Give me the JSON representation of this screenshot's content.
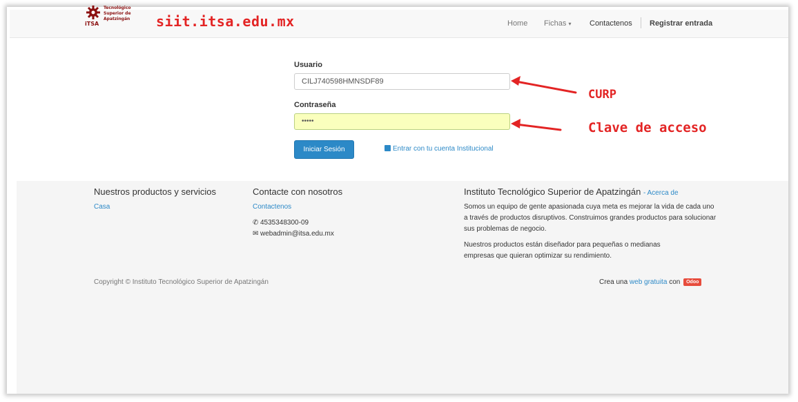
{
  "header": {
    "logo": {
      "lines": [
        "Tecnológico",
        "Superior de",
        "Apatzingán"
      ],
      "itsa": "iTSA"
    },
    "site_url": "siit.itsa.edu.mx",
    "nav": {
      "home": "Home",
      "fichas": "Fichas",
      "contactenos": "Contactenos",
      "registrar": "Registrar entrada"
    }
  },
  "login": {
    "usuario_label": "Usuario",
    "usuario_value": "CILJ740598HMNSDF89",
    "contrasena_label": "Contraseña",
    "contrasena_value": "•••••",
    "submit_label": "Iniciar Sesión",
    "institutional_link": "Entrar con tu cuenta Institucional"
  },
  "annotations": {
    "curp": "CURP",
    "clave": "Clave de acceso",
    "color": "#e32424"
  },
  "footer": {
    "products_heading": "Nuestros productos y servicios",
    "products_link": "Casa",
    "contact_heading": "Contacte con nosotros",
    "contact_link": "Contactenos",
    "phone": "4535348300-09",
    "email": "webadmin@itsa.edu.mx",
    "about_heading": "Instituto Tecnológico Superior de Apatzingán",
    "about_link": "- Acerca de",
    "about_p1": "Somos un equipo de gente apasionada cuya meta es mejorar la vida de cada uno a través de productos disruptivos. Construimos grandes productos para solucionar sus problemas de negocio.",
    "about_p2": "Nuestros productos están diseñador para pequeñas o medianas empresas que quieran optimizar su rendimiento.",
    "copyright": "Copyright © Instituto Tecnológico Superior de Apatzingán",
    "crea_prefix": "Crea una",
    "crea_link": "web gratuita",
    "crea_suffix": "con",
    "odoo_badge": "Odoo"
  },
  "colors": {
    "primary": "#2c89c7",
    "brand": "#8b1010",
    "autofill": "#faffbd"
  },
  "icons": {
    "phone": "phone-icon",
    "email": "envelope-icon",
    "institutional": "institution-icon"
  }
}
